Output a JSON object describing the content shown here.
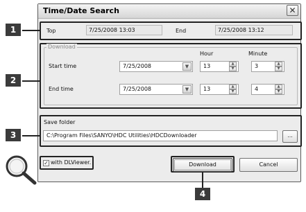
{
  "window": {
    "title": "Time/Date Search",
    "close_glyph": "✕"
  },
  "summary": {
    "top_label": "Top",
    "top_value": "7/25/2008 13:03",
    "end_label": "End",
    "end_value": "7/25/2008 13:12"
  },
  "download": {
    "group_label": "Download",
    "hour_label": "Hour",
    "minute_label": "Minute",
    "start_label": "Start time",
    "start_date": "7/25/2008",
    "start_hour": "13",
    "start_minute": "3",
    "end_label": "End time",
    "end_date": "7/25/2008",
    "end_hour": "13",
    "end_minute": "4"
  },
  "save": {
    "label": "Save folder",
    "path": "C:\\Program Files\\SANYO\\HDC Utilities\\HDCDownloader",
    "browse": "..."
  },
  "option": {
    "dlviewer_label": "with DLViewer.",
    "dlviewer_checked": true,
    "check_glyph": "✓"
  },
  "buttons": {
    "download": "Download",
    "cancel": "Cancel"
  },
  "callouts": [
    "1",
    "2",
    "3",
    "4"
  ],
  "icons": {
    "magnifier": "magnifier-icon"
  }
}
